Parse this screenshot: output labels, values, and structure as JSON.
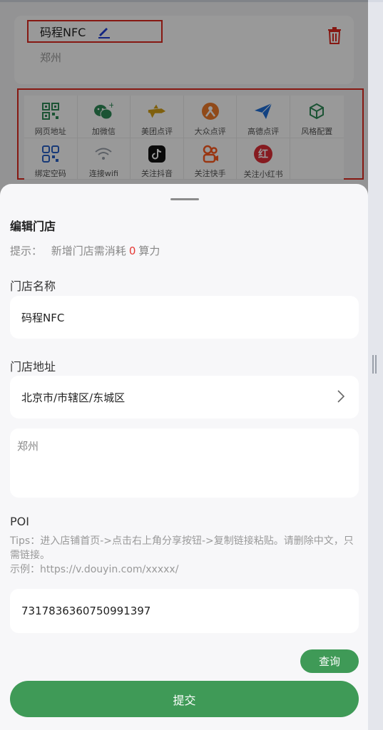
{
  "store": {
    "name": "码程NFC",
    "city": "郑州"
  },
  "functions": [
    {
      "label": "网页地址",
      "icon": "qr-code-icon",
      "color": "#2e8b57"
    },
    {
      "label": "加微信",
      "icon": "wechat-icon",
      "color": "#2e8b57"
    },
    {
      "label": "美团点评",
      "icon": "meituan-icon",
      "color": "#d4a017"
    },
    {
      "label": "大众点评",
      "icon": "dianping-icon",
      "color": "#f07c2b"
    },
    {
      "label": "高德点评",
      "icon": "amap-icon",
      "color": "#1e6fd9"
    },
    {
      "label": "风格配置",
      "icon": "cube-icon",
      "color": "#2e8b57"
    },
    {
      "label": "绑定空码",
      "icon": "bind-code-icon",
      "color": "#2962c9"
    },
    {
      "label": "连接wifi",
      "icon": "wifi-icon",
      "color": "#9aa0aa"
    },
    {
      "label": "关注抖音",
      "icon": "douyin-icon",
      "color": "#111111"
    },
    {
      "label": "关注快手",
      "icon": "kuaishou-icon",
      "color": "#ff5a1f"
    },
    {
      "label": "关注小红书",
      "icon": "xiaohongshu-icon",
      "color": "#e02d36"
    }
  ],
  "sheet": {
    "title": "编辑门店",
    "hint_prefix": "提示：",
    "hint_text": "新增门店需消耗",
    "hint_cost": "0",
    "hint_unit": "算力",
    "name_label": "门店名称",
    "name_value": "码程NFC",
    "address_label": "门店地址",
    "address_value": "北京市/市辖区/东城区",
    "detail_value": "郑州",
    "poi_label": "POI",
    "tips_line1": "Tips：进入店铺首页->点击右上角分享按钮->复制链接粘贴。请删除中文，只需链接。",
    "tips_line2": "示例：https://v.douyin.com/xxxxx/",
    "poi_value": "7317836360750991397",
    "query_label": "查询",
    "submit_label": "提交"
  },
  "colors": {
    "accent": "#3f9a57",
    "highlight": "#e0281e",
    "cost": "#e53935"
  }
}
